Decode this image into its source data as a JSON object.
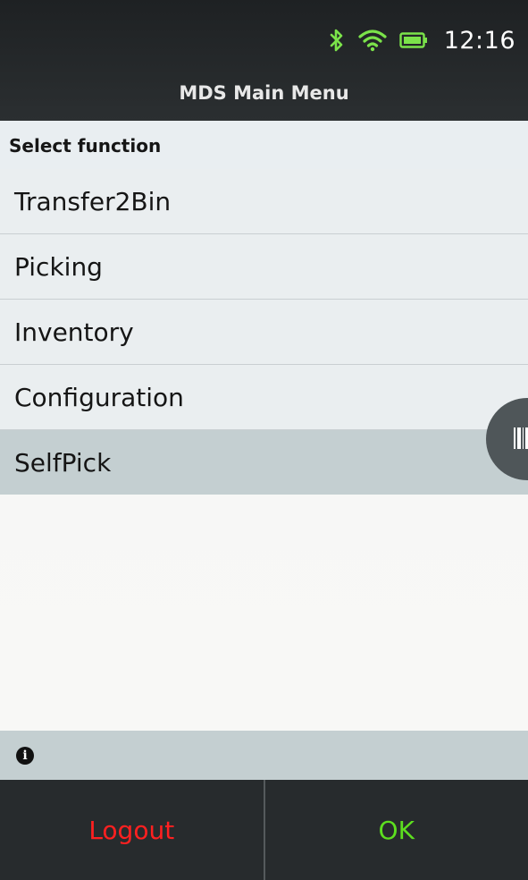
{
  "status_bar": {
    "time": "12:16",
    "icons": [
      "bluetooth-icon",
      "wifi-icon",
      "battery-icon"
    ],
    "icon_color": "#7be34a"
  },
  "header": {
    "title": "MDS Main Menu"
  },
  "menu": {
    "section_label": "Select function",
    "items": [
      {
        "label": "Transfer2Bin"
      },
      {
        "label": "Picking"
      },
      {
        "label": "Inventory"
      },
      {
        "label": "Configuration"
      },
      {
        "label": "SelfPick",
        "selected": true
      }
    ]
  },
  "scan_button": {
    "icon": "barcode-icon"
  },
  "info_bar": {
    "icon": "info-icon"
  },
  "footer": {
    "left_button": "Logout",
    "right_button": "OK",
    "left_color": "#ff2020",
    "right_color": "#5ddf1f"
  }
}
